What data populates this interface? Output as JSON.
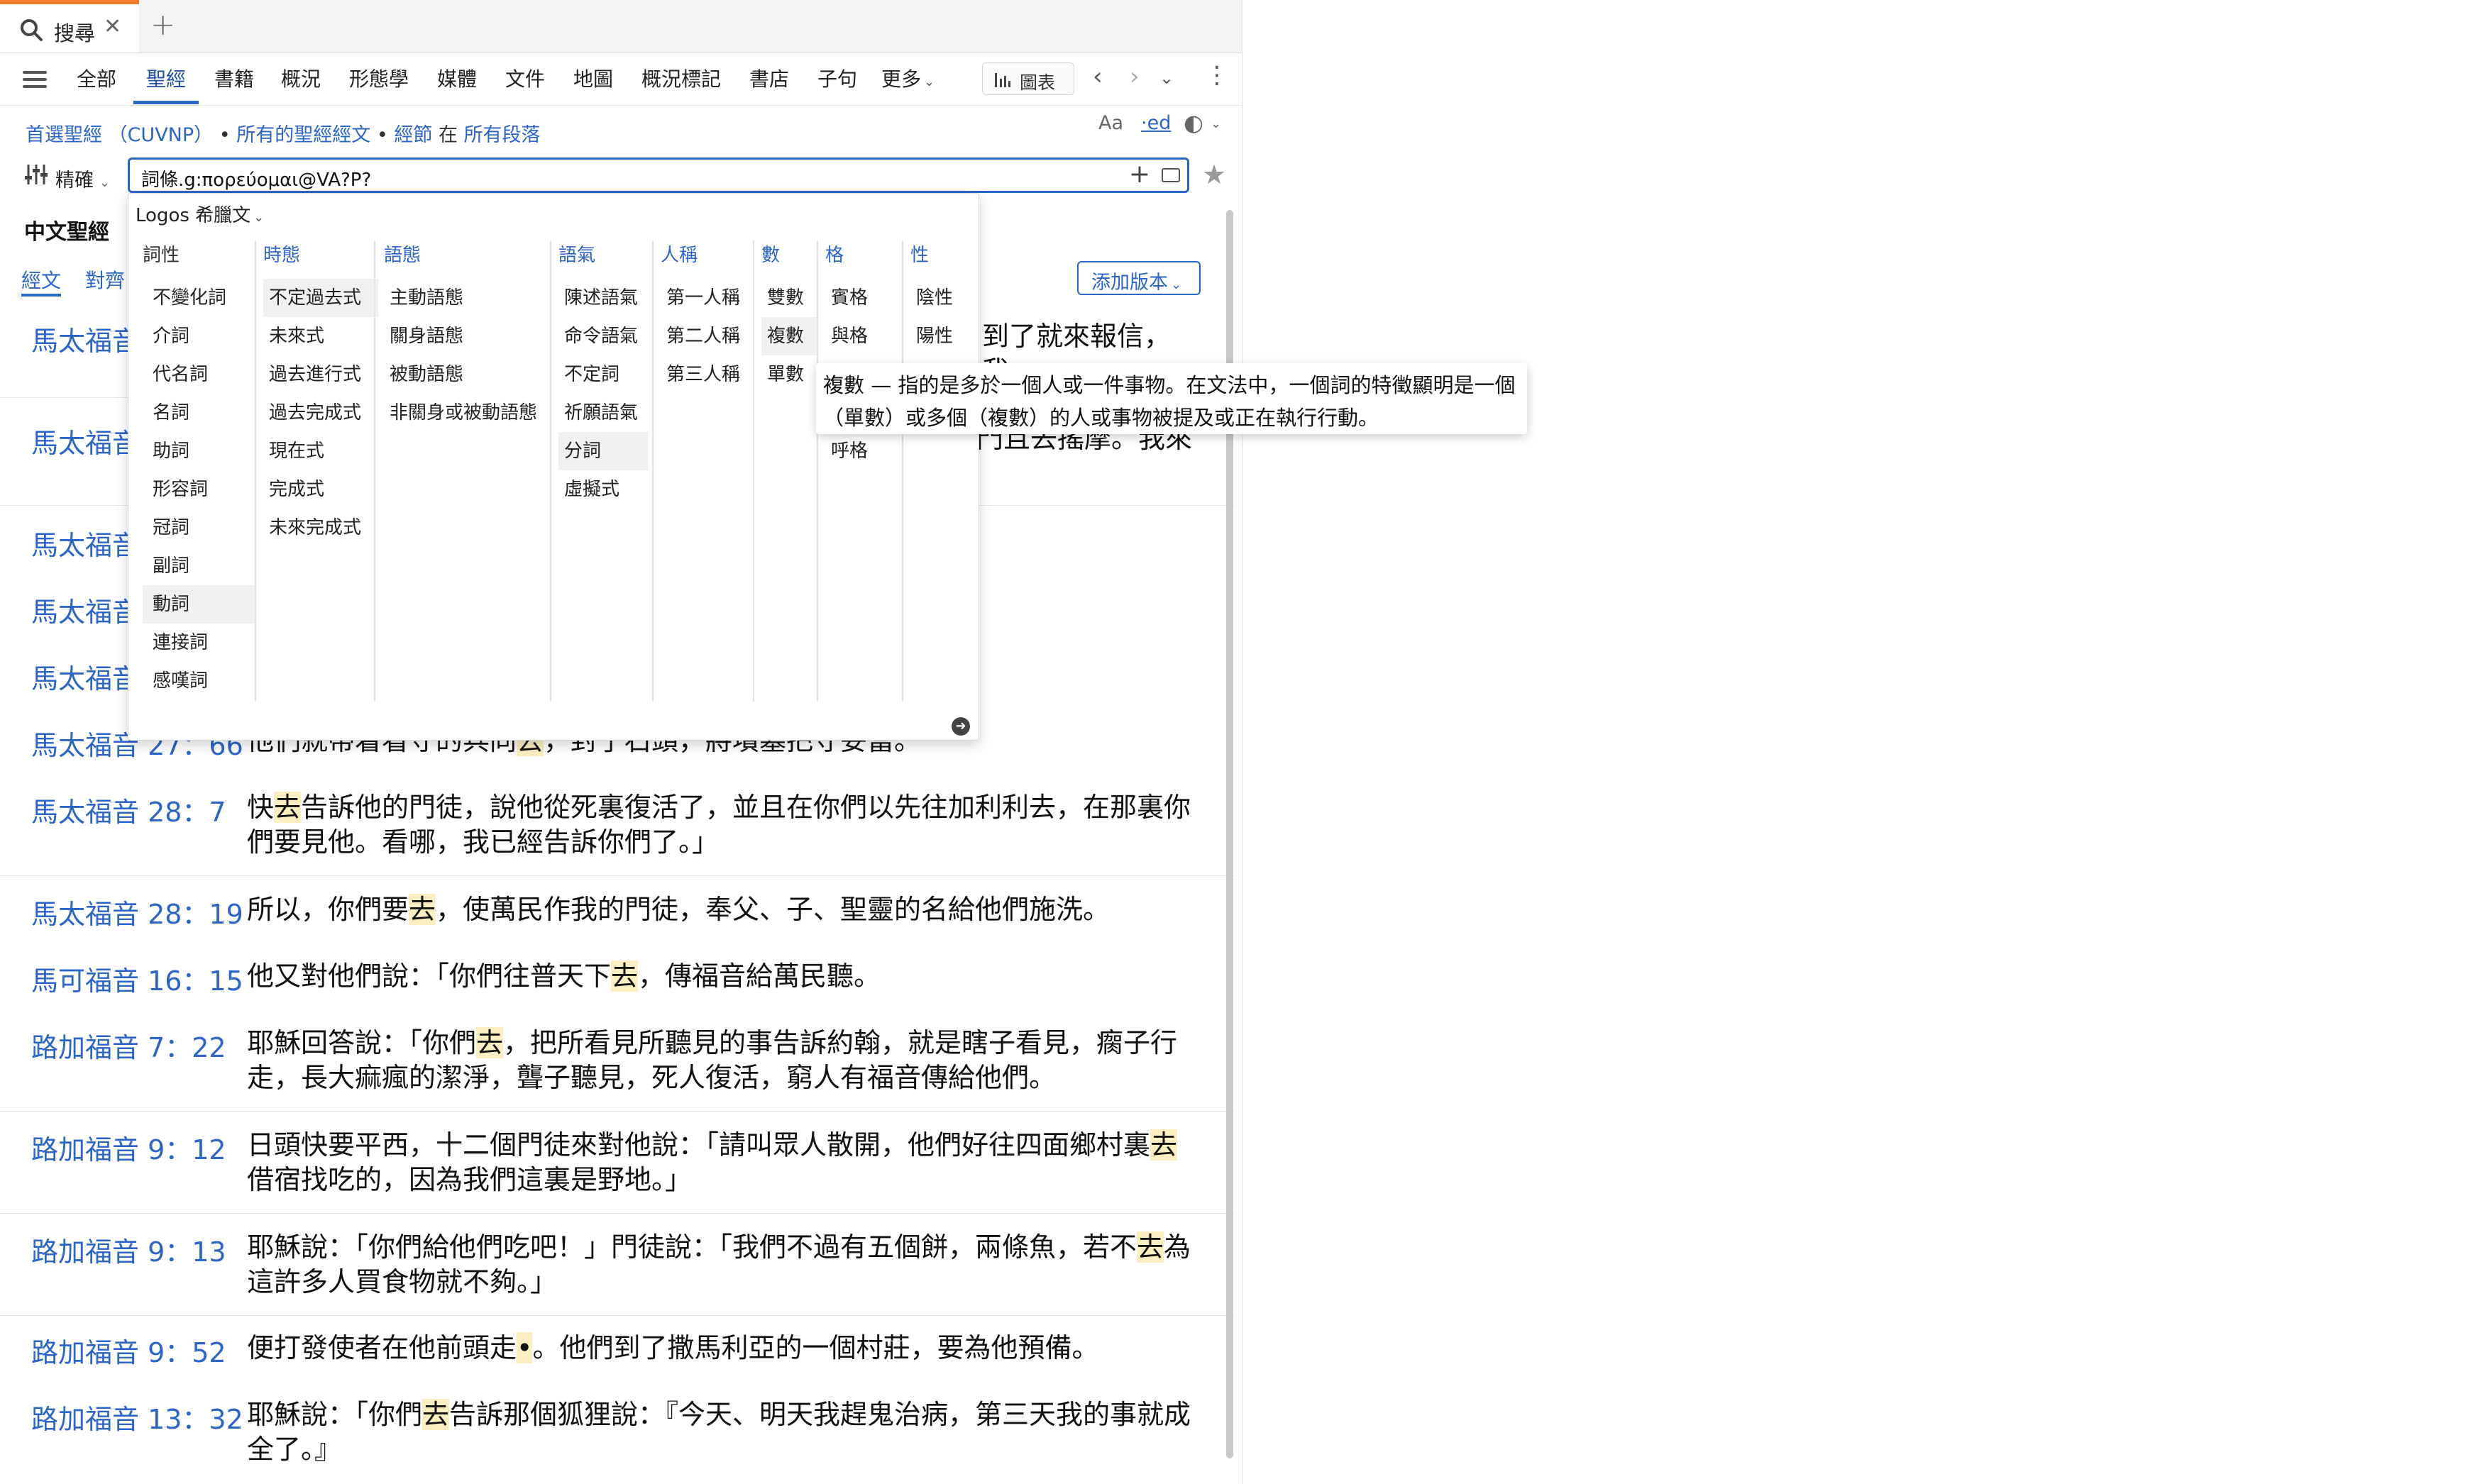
{
  "tab": {
    "title": "搜尋",
    "close": "✕",
    "new": "+"
  },
  "toolbar": {
    "tabs": [
      "全部",
      "聖經",
      "書籍",
      "概況",
      "形態學",
      "媒體",
      "文件",
      "地圖",
      "概況標記",
      "書店",
      "子句",
      "更多"
    ],
    "active_tab": "聖經",
    "chart_label": "圖表"
  },
  "scope": {
    "preferred_bible": "首選聖經 （CUVNP）",
    "all_bible_text": "所有的聖經經文",
    "scripture": "經節",
    "in": "在",
    "all_paragraphs": "所有段落"
  },
  "display_options": {
    "font": "Aa",
    "edit": "·ed",
    "theme": "◐"
  },
  "search": {
    "precision_label": "精確",
    "query": "詞條.g:πορεύομαι@VA?P?"
  },
  "panel": {
    "title": "中文聖經",
    "tab_text": "經文",
    "tab_align": "對齊",
    "add_version": "添加版本"
  },
  "morph": {
    "source": "Logos 希臘文",
    "columns": [
      {
        "head": "詞性",
        "items": [
          "不變化詞",
          "介詞",
          "代名詞",
          "名詞",
          "助詞",
          "形容詞",
          "冠詞",
          "副詞",
          "動詞",
          "連接詞",
          "感嘆詞"
        ]
      },
      {
        "head": "時態",
        "items": [
          "不定過去式",
          "未來式",
          "過去進行式",
          "過去完成式",
          "現在式",
          "完成式",
          "未來完成式"
        ]
      },
      {
        "head": "語態",
        "items": [
          "主動語態",
          "關身語態",
          "被動語態",
          "非關身或被動語態"
        ]
      },
      {
        "head": "語氣",
        "items": [
          "陳述語氣",
          "命令語氣",
          "不定詞",
          "祈願語氣",
          "分詞",
          "虛擬式"
        ]
      },
      {
        "head": "人稱",
        "items": [
          "第一人稱",
          "第二人稱",
          "第三人稱"
        ]
      },
      {
        "head": "數",
        "items": [
          "雙數",
          "複數",
          "單數"
        ]
      },
      {
        "head": "格",
        "items": [
          "賓格",
          "與格",
          "",
          "",
          "呼格"
        ]
      },
      {
        "head": "性",
        "items": [
          "陰性",
          "陽性"
        ]
      }
    ]
  },
  "tooltip": "複數 — 指的是多於一個人或一件事物。在文法中，一個詞的特徵顯明是一個（單數）或多個（複數）的人或事物被提及或正在執行行動。",
  "results": [
    {
      "ref": "馬太福音",
      "pre": "",
      "hit": "",
      "post": "到了就來報信，我"
    },
    {
      "ref": "馬太福音",
      "pre": "",
      "hit": "",
      "post": "門且去",
      "tail": "搖摩。我來"
    },
    {
      "ref": "馬太福音",
      "pre": "",
      "hit": "",
      "post": ""
    },
    {
      "ref": "馬太福音",
      "pre": "",
      "hit": "",
      "post": ""
    },
    {
      "ref": "馬太福音",
      "pre": "",
      "hit": "",
      "post": ""
    },
    {
      "ref": "馬太福音 27：66",
      "pre": "他們就帶着看守的兵同",
      "hit": "去",
      "post": "，封了石頭，將墳墓把守妥當。"
    },
    {
      "ref": "馬太福音 28：7",
      "pre": "快",
      "hit": "去",
      "post": "告訴他的門徒，說他從死裏復活了，並且在你們以先往加利利去，在那裏你們要見他。看哪，我已經告訴你們了。」"
    },
    {
      "ref": "馬太福音 28：19",
      "pre": "所以，你們要",
      "hit": "去",
      "post": "，使萬民作我的門徒，奉父、子、聖靈的名給他們施洗。"
    },
    {
      "ref": "馬可福音 16：15",
      "pre": "他又對他們說：「你們往普天下",
      "hit": "去",
      "post": "，傳福音給萬民聽。"
    },
    {
      "ref": "路加福音 7：22",
      "pre": "耶穌回答說：「你們",
      "hit": "去",
      "post": "，把所看見所聽見的事告訴約翰，就是瞎子看見，瘸子行走，長大痲瘋的潔淨，聾子聽見，死人復活，窮人有福音傳給他們。"
    },
    {
      "ref": "路加福音 9：12",
      "pre": "日頭快要平西，十二個門徒來對他說：「請叫眾人散開，他們好往四面鄉村裏",
      "hit": "去",
      "post": "借宿找吃的，因為我們這裏是野地。」"
    },
    {
      "ref": "路加福音 9：13",
      "pre": "耶穌說：「你們給他們吃吧！」門徒說：「我們不過有五個餅，兩條魚，若不",
      "hit": "去",
      "post": "為這許多人買食物就不夠。」"
    },
    {
      "ref": "路加福音 9：52",
      "pre": "便打發使者在他前頭走",
      "hit": "•",
      "post": "。他們到了撒馬利亞的一個村莊，要為他預備。"
    },
    {
      "ref": "路加福音 13：32",
      "pre": "耶穌說：「你們",
      "hit": "去",
      "post": "告訴那個狐狸說：『今天、明天我趕鬼治病，第三天我的事就成全了。』"
    }
  ]
}
